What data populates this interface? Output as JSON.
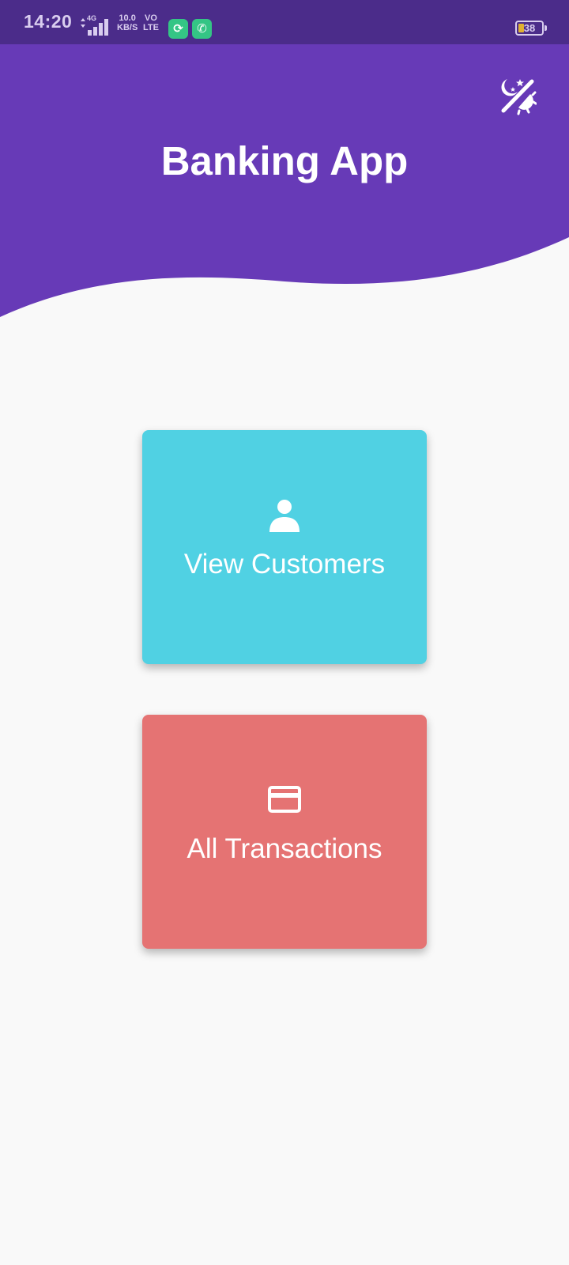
{
  "status_bar": {
    "time": "14:20",
    "network": "4G",
    "speed_value": "10.0",
    "speed_unit": "KB/S",
    "volte_top": "VO",
    "volte_bottom": "LTE",
    "battery_level": "38",
    "notification_icons": [
      "sync-app-icon",
      "chat-app-icon"
    ]
  },
  "header": {
    "title": "Banking App",
    "theme_toggle_icon": "theme-toggle-icon",
    "background_color": "#673ab7"
  },
  "cards": [
    {
      "label": "View Customers",
      "icon": "person-icon",
      "color": "#50d1e3"
    },
    {
      "label": "All Transactions",
      "icon": "credit-card-icon",
      "color": "#e57373"
    }
  ]
}
